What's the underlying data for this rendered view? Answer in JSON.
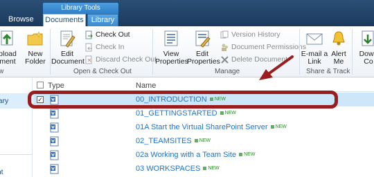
{
  "tabs": {
    "browse": "Browse",
    "context_group": "Library Tools",
    "documents": "Documents",
    "library": "Library"
  },
  "ribbon": {
    "upload": "pload\nment",
    "new_folder": "New\nFolder",
    "edit_document": "Edit\nDocument",
    "check_out": "Check Out",
    "check_in": "Check In",
    "discard_check_out": "Discard Check Out",
    "group_open_checkout": "Open & Check Out",
    "view_properties": "View\nProperties",
    "edit_properties": "Edit\nProperties",
    "version_history": "Version History",
    "document_permissions": "Document Permissions",
    "delete_document": "Delete Document",
    "group_manage": "Manage",
    "email_link": "E-mail a\nLink",
    "alert_me": "Alert\nMe",
    "group_share_track": "Share & Track",
    "download_copy": "Down\nCo",
    "group_new": "w"
  },
  "leftnav": {
    "library_item": "ibrary",
    "bottom_item": "ent"
  },
  "list": {
    "header_type": "Type",
    "header_name": "Name",
    "new_label": "NEW",
    "rows": [
      {
        "name": "00_INTRODUCTION",
        "selected": true,
        "check": "✓"
      },
      {
        "name": "01_GETTINGSTARTED",
        "selected": false,
        "check": ""
      },
      {
        "name": "01A Start the Virtual SharePoint Server",
        "selected": false,
        "check": ""
      },
      {
        "name": "02_TEAMSITES",
        "selected": false,
        "check": ""
      },
      {
        "name": "02a Working with a Team Site",
        "selected": false,
        "check": ""
      },
      {
        "name": "03 WORKSPACES",
        "selected": false,
        "check": ""
      }
    ]
  },
  "colors": {
    "accent": "#1f73c6",
    "highlight_ring": "#9b1c1c",
    "selected_row": "#cde6fa"
  }
}
